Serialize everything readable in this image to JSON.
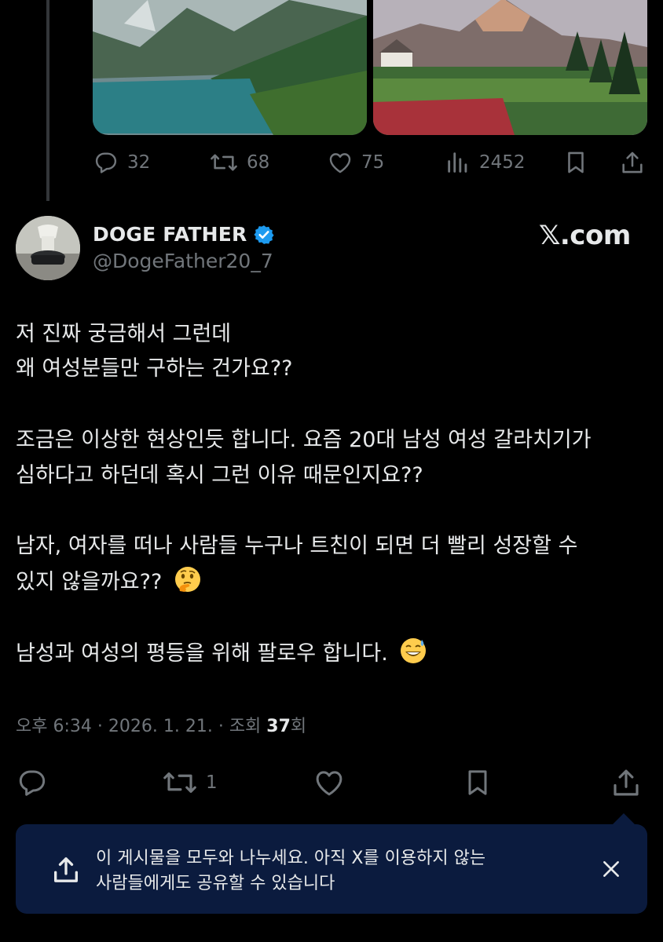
{
  "prev_tweet": {
    "reply_count": "32",
    "retweet_count": "68",
    "like_count": "75",
    "view_count": "2452"
  },
  "tweet": {
    "display_name": "DOGE FATHER",
    "handle": "@DogeFather20_7",
    "watermark": "𝕏.com",
    "lines": [
      "저 진짜 궁금해서 그런데",
      "왜 여성분들만 구하는 건가요??",
      "조금은 이상한 현상인듯 합니다. 요즘 20대 남성 여성 갈라치기가",
      "심하다고 하던데 혹시 그런 이유 때문인지요??",
      "남자, 여자를 떠나  사람들 누구나 트친이 되면 더 빨리 성장할 수",
      "있지 않을까요?? ",
      "남성과 여성의 평등을 위해 팔로우 합니다. "
    ],
    "time": "오후 6:34",
    "date": "2026. 1. 21.",
    "views_label": "조회",
    "views_count": "37",
    "views_suffix": "회",
    "retweet_count": "1"
  },
  "toast": {
    "line1": "이 게시물을 모두와 나누세요. 아직 X를 이용하지 않는",
    "line2": "사람들에게도 공유할 수 있습니다"
  },
  "icons": {
    "reply": "reply-icon",
    "retweet": "retweet-icon",
    "like": "heart-icon",
    "views": "analytics-icon",
    "bookmark": "bookmark-icon",
    "share": "share-icon",
    "verified": "verified-badge-icon",
    "close": "close-icon",
    "thinking": "thinking-face-emoji",
    "sweat": "grinning-sweat-emoji"
  },
  "colors": {
    "background": "#000000",
    "text": "#e7e9ea",
    "muted": "#71767b",
    "verified": "#1d9bf0",
    "toast_bg": "#0b1b3e"
  }
}
